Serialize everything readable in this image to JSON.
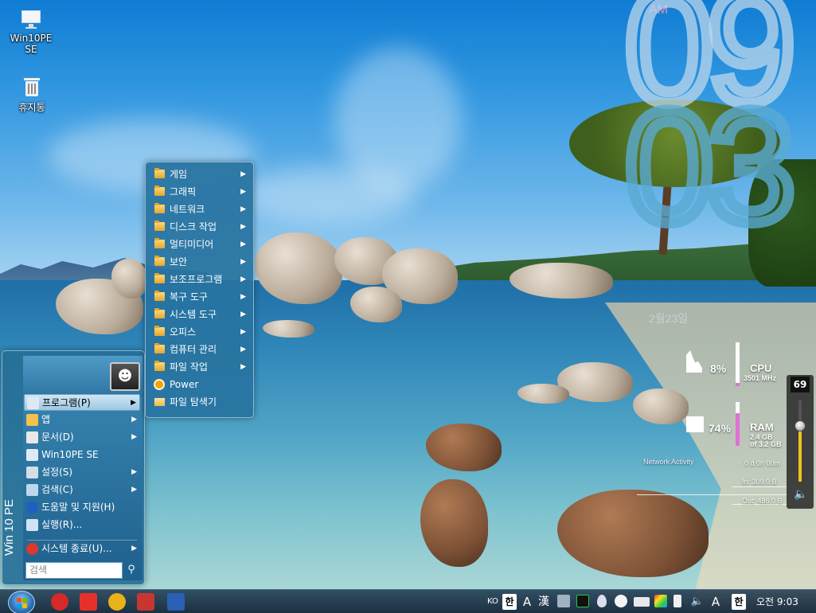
{
  "desktop": {
    "icons": [
      {
        "label": "Win10PE SE",
        "icon": "monitor-icon"
      },
      {
        "label": "휴지통",
        "icon": "recycle-bin-icon"
      }
    ]
  },
  "clock_widget": {
    "ampm": "AM",
    "hour": "09",
    "minute": "03",
    "date": "2월23일"
  },
  "system_monitor": {
    "cpu": {
      "label": "CPU",
      "percent": "8%",
      "freq": "3501 MHz",
      "usage": 0.08
    },
    "ram": {
      "label": "RAM",
      "percent": "74%",
      "used": "2.4 GB",
      "total": "of 3.2 GB",
      "usage": 0.74
    },
    "network": {
      "title": "Network Activity",
      "uptime": "0 d 0h 00m",
      "in": "In: 309.0 B",
      "out": "Out: 486.0 B"
    }
  },
  "volume": {
    "value": "69",
    "level": 0.69
  },
  "start_menu": {
    "side_title": "Win 10 PE",
    "items": [
      {
        "label": "프로그램(P)",
        "icon": "programs-icon",
        "has_submenu": true,
        "selected": true
      },
      {
        "label": "앱",
        "icon": "apps-icon",
        "has_submenu": true
      },
      {
        "label": "문서(D)",
        "icon": "documents-icon",
        "has_submenu": true
      },
      {
        "label": "Win10PE SE",
        "icon": "monitor-icon",
        "has_submenu": false
      },
      {
        "label": "설정(S)",
        "icon": "settings-icon",
        "has_submenu": true
      },
      {
        "label": "검색(C)",
        "icon": "search-icon",
        "has_submenu": true
      },
      {
        "label": "도움말 및 지원(H)",
        "icon": "help-icon",
        "has_submenu": false
      },
      {
        "label": "실행(R)...",
        "icon": "run-icon",
        "has_submenu": false
      },
      {
        "label": "시스템 종료(U)...",
        "icon": "shutdown-icon",
        "has_submenu": true
      }
    ],
    "search_placeholder": "검색",
    "submenu_arrow": "▶"
  },
  "programs_menu": {
    "items": [
      {
        "label": "게임",
        "type": "folder"
      },
      {
        "label": "그래픽",
        "type": "folder"
      },
      {
        "label": "네트워크",
        "type": "folder"
      },
      {
        "label": "디스크 작업",
        "type": "folder"
      },
      {
        "label": "멀티미디어",
        "type": "folder"
      },
      {
        "label": "보안",
        "type": "folder"
      },
      {
        "label": "보조프로그램",
        "type": "folder"
      },
      {
        "label": "복구 도구",
        "type": "folder"
      },
      {
        "label": "시스템 도구",
        "type": "folder"
      },
      {
        "label": "오피스",
        "type": "folder"
      },
      {
        "label": "컴퓨터 관리",
        "type": "folder"
      },
      {
        "label": "파일 작업",
        "type": "folder"
      },
      {
        "label": "Power",
        "type": "power"
      },
      {
        "label": "파일 탐색기",
        "type": "explorer"
      }
    ]
  },
  "taskbar": {
    "pinned": [
      {
        "name": "power-app-icon",
        "color": "#d42a2a"
      },
      {
        "name": "anydesk-icon",
        "color": "#e8302a"
      },
      {
        "name": "chrome-icon",
        "color": "#e8b21a"
      },
      {
        "name": "network-app-icon",
        "color": "#c7372f"
      },
      {
        "name": "save-app-icon",
        "color": "#2a60b5"
      }
    ],
    "tray": {
      "lang": "KO",
      "ime_han": "한",
      "ime_a": "A",
      "ime_hanja": "漢",
      "ime_han2": "한",
      "ime_a2": "A",
      "clock": "오전 9:03"
    }
  },
  "colors": {
    "menu_bg": "#266e96",
    "selected_item": "#cfe6f5",
    "accent_pink": "#e26fd6",
    "volume_fill": "#f1c21b"
  }
}
